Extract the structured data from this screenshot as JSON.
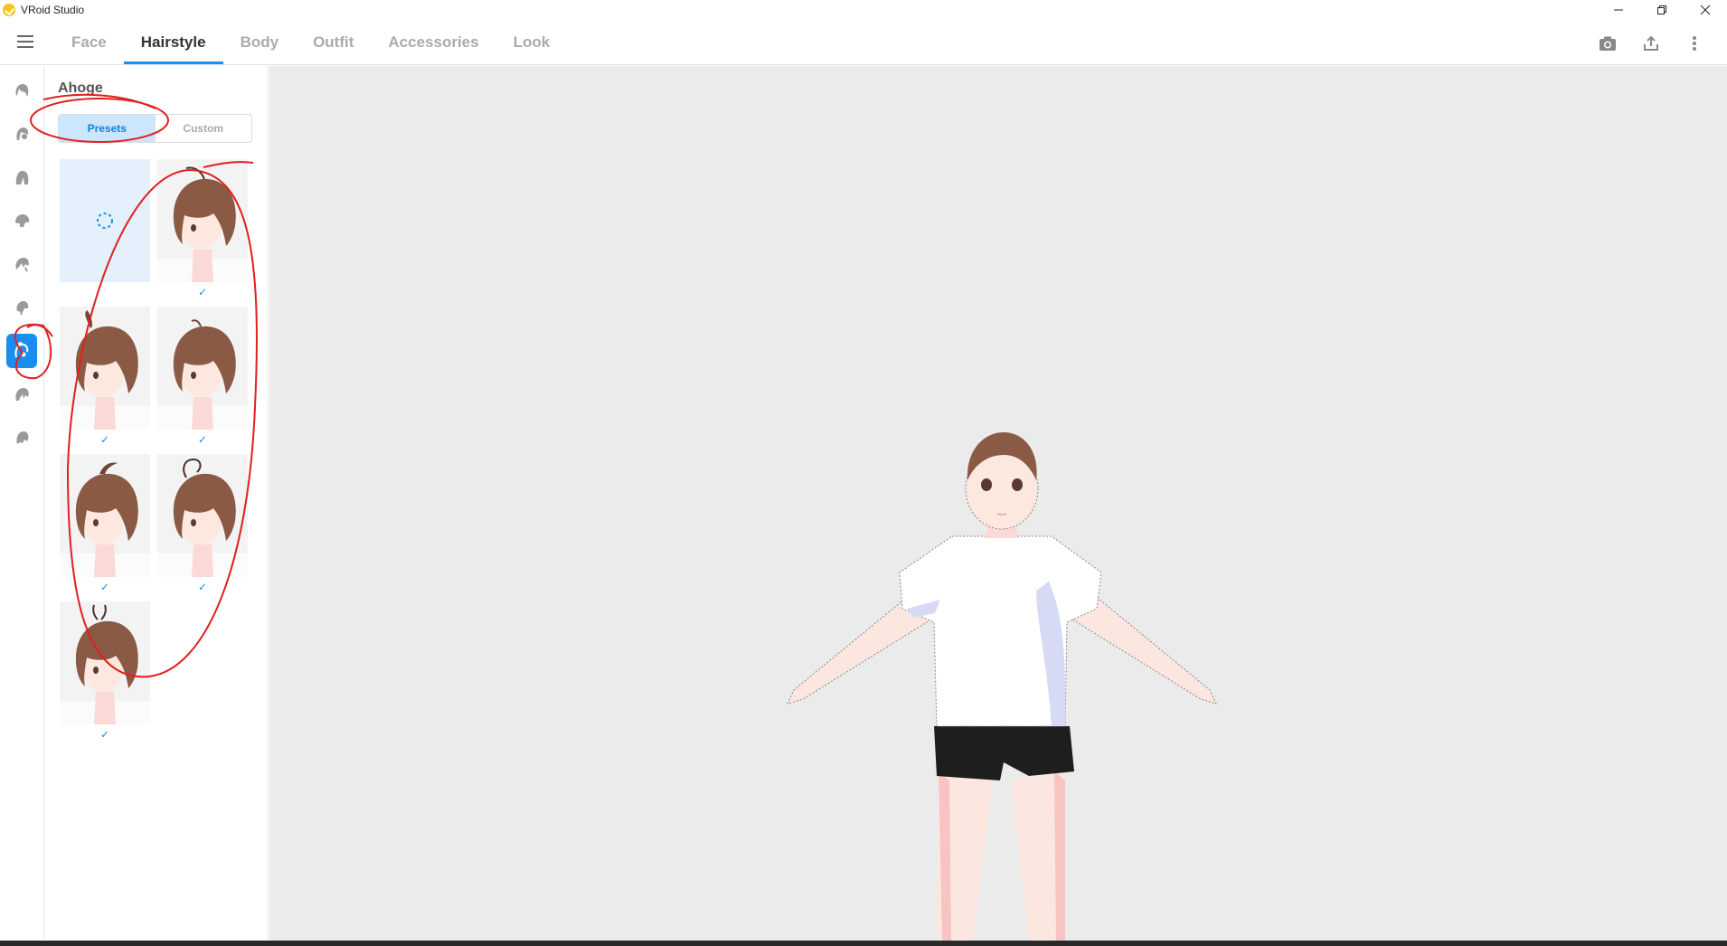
{
  "window": {
    "title": "VRoid Studio"
  },
  "nav": {
    "tabs": [
      {
        "label": "Face",
        "active": false
      },
      {
        "label": "Hairstyle",
        "active": true
      },
      {
        "label": "Body",
        "active": false
      },
      {
        "label": "Outfit",
        "active": false
      },
      {
        "label": "Accessories",
        "active": false
      },
      {
        "label": "Look",
        "active": false
      }
    ],
    "actions": [
      "camera-icon",
      "export-icon",
      "more-vertical-icon"
    ]
  },
  "rail": {
    "items": [
      {
        "icon": "base-hair-icon",
        "active": false
      },
      {
        "icon": "front-hair-icon",
        "active": false
      },
      {
        "icon": "back-hair-icon",
        "active": false
      },
      {
        "icon": "side-hair-icon",
        "active": false
      },
      {
        "icon": "bangs-icon",
        "active": false
      },
      {
        "icon": "sideburn-icon",
        "active": false
      },
      {
        "icon": "ahoge-icon",
        "active": true
      },
      {
        "icon": "extra-hair-icon",
        "active": false
      },
      {
        "icon": "hair-tail-icon",
        "active": false
      }
    ]
  },
  "panel": {
    "title": "Ahoge",
    "segments": {
      "presets": "Presets",
      "custom": "Custom",
      "selected": "presets"
    },
    "presets": [
      {
        "type": "none",
        "checked": false
      },
      {
        "type": "ahoge-1",
        "checked": true
      },
      {
        "type": "ahoge-2",
        "checked": true
      },
      {
        "type": "ahoge-3",
        "checked": true
      },
      {
        "type": "ahoge-4",
        "checked": true
      },
      {
        "type": "ahoge-5",
        "checked": true
      },
      {
        "type": "ahoge-6",
        "checked": true
      }
    ],
    "check_glyph": "✓"
  },
  "colors": {
    "accent": "#1a8ef0",
    "hair": "#8a5a44",
    "skin": "#fbe7df",
    "annotation": "#e02020",
    "viewport_bg": "#ebebeb"
  }
}
